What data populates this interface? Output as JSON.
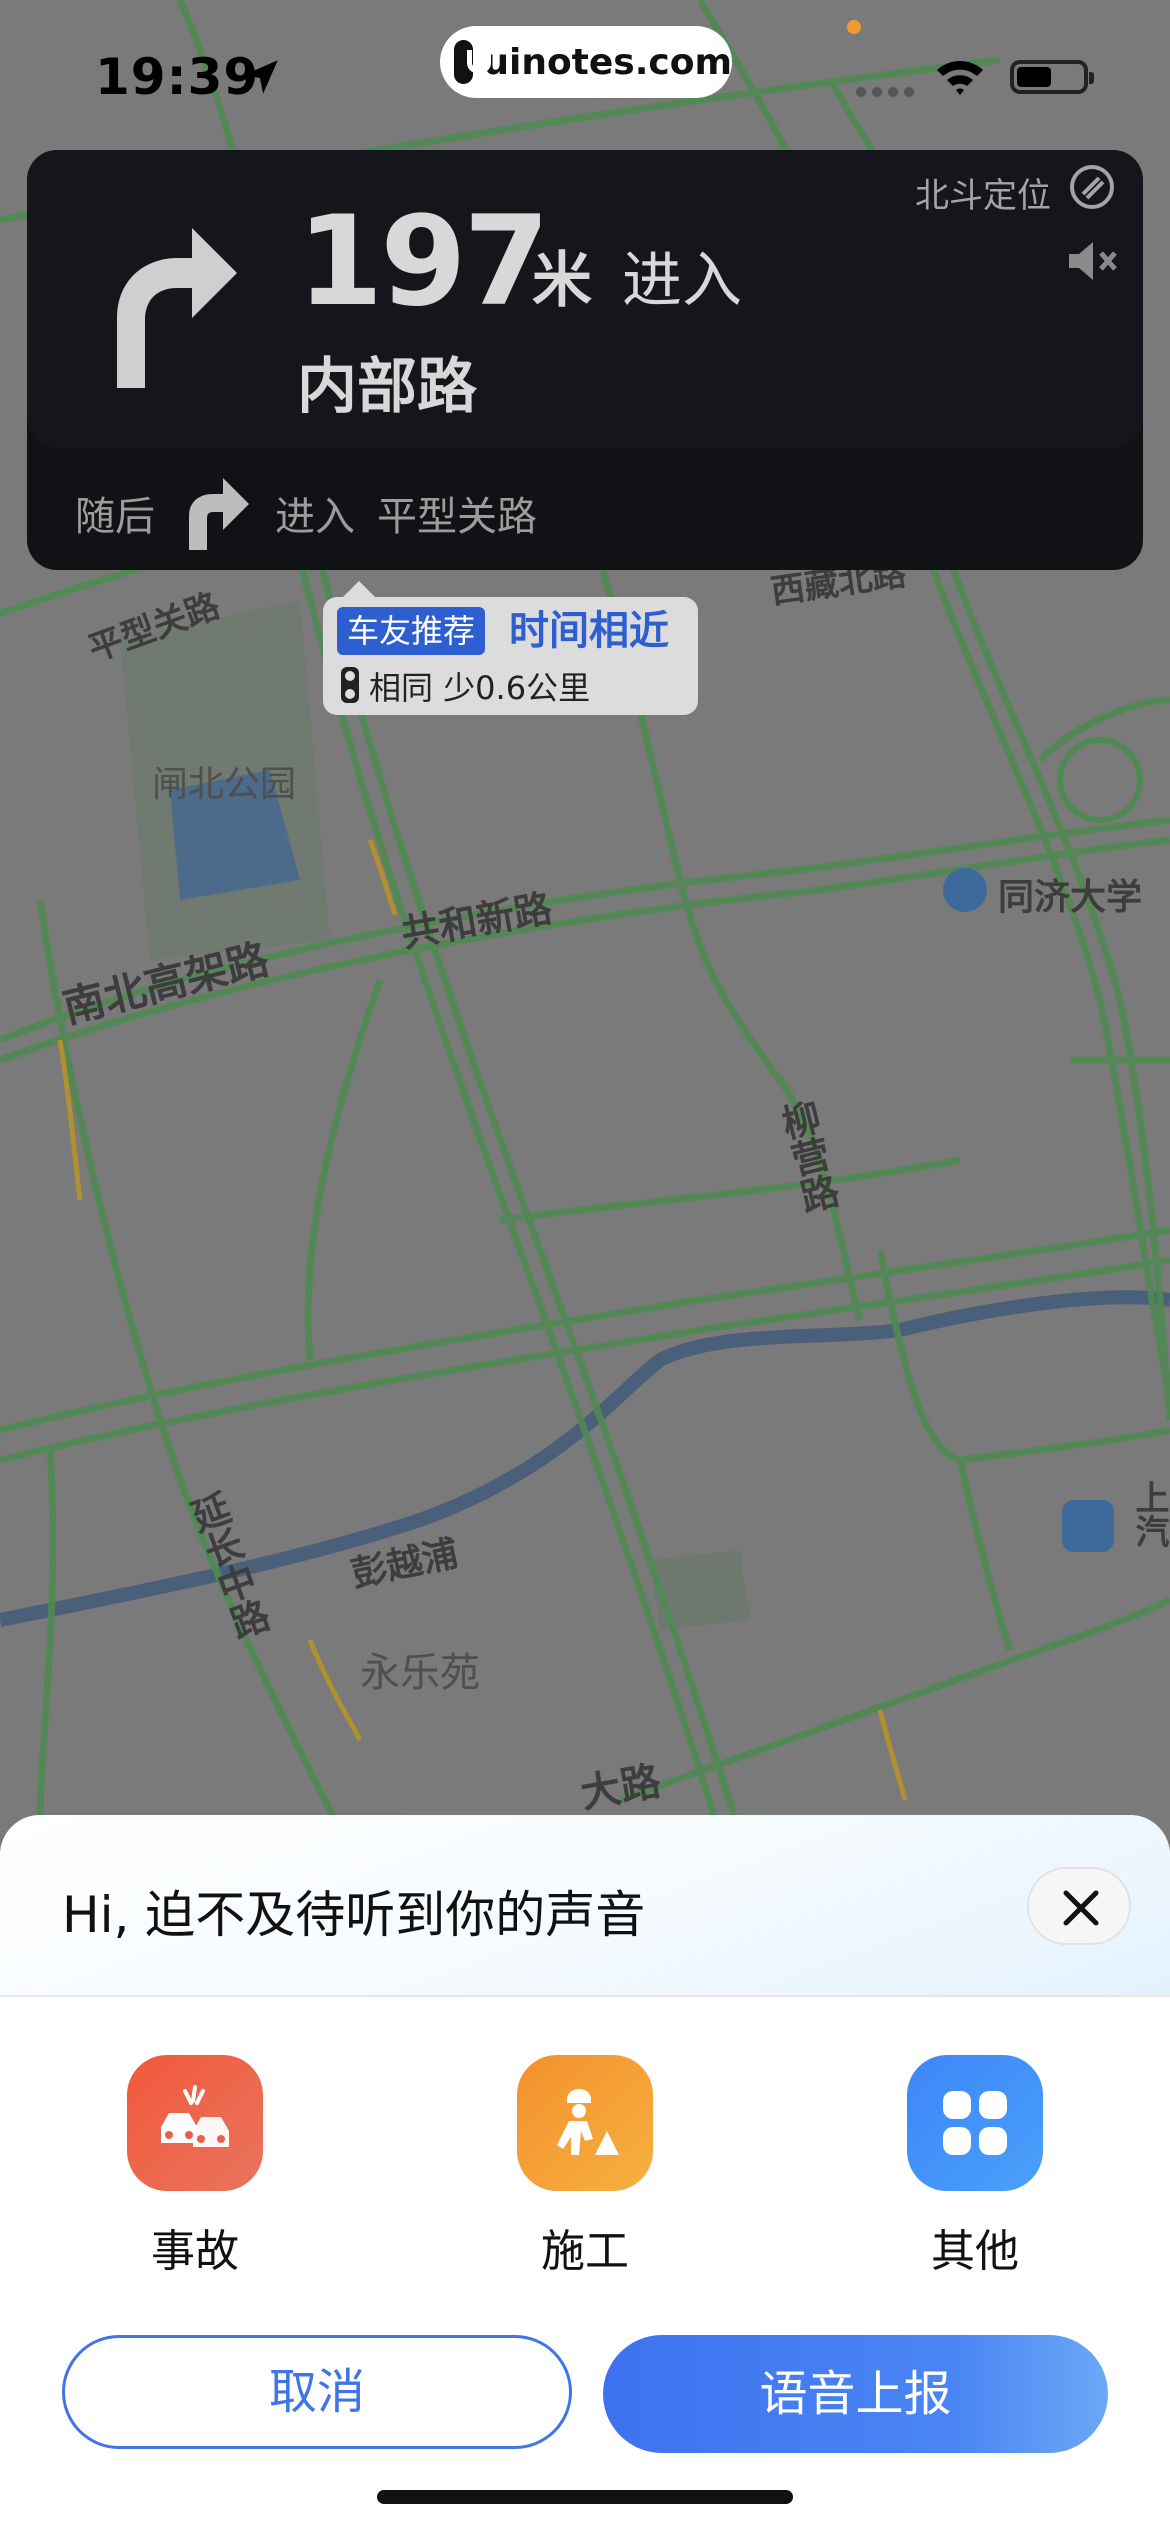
{
  "status_bar": {
    "time": "19:39",
    "watermark": "uinotes.com",
    "icons": [
      "location-arrow-icon",
      "wifi-icon",
      "battery-icon"
    ]
  },
  "navigation": {
    "distance": "197",
    "unit": "米",
    "action": "进入",
    "road": "内部路",
    "positioning": "北斗定位",
    "next": {
      "label": "随后",
      "action": "进入",
      "road": "平型关路"
    }
  },
  "route_tip": {
    "badge": "车友推荐",
    "headline": "时间相近",
    "detail": "相同 少0.6公里"
  },
  "map": {
    "labels": {
      "pingxingguan": "平型关路",
      "xizang_north": "西藏北路",
      "zhabei_park": "闸北公园",
      "tongji": "同济大学",
      "nanbei": "南北高架路",
      "gonghexin": "共和新路",
      "liuying": "柳营路",
      "yanchang": "延长中路",
      "pengyuepu": "彭越浦",
      "yongleyuan": "永乐苑",
      "shang_qi": "上汽",
      "bottom_road": "大路"
    }
  },
  "sheet": {
    "title": "Hi, 迫不及待听到你的声音",
    "options": [
      {
        "label": "事故",
        "icon": "car-accident-icon",
        "color": "#f2593c"
      },
      {
        "label": "施工",
        "icon": "construction-worker-icon",
        "color": "#f4912c"
      },
      {
        "label": "其他",
        "icon": "grid-icon",
        "color": "#3d86f7"
      }
    ],
    "cancel_label": "取消",
    "voice_label": "语音上报"
  },
  "colors": {
    "accent": "#3f75e8",
    "nav_panel": "#15161b"
  }
}
